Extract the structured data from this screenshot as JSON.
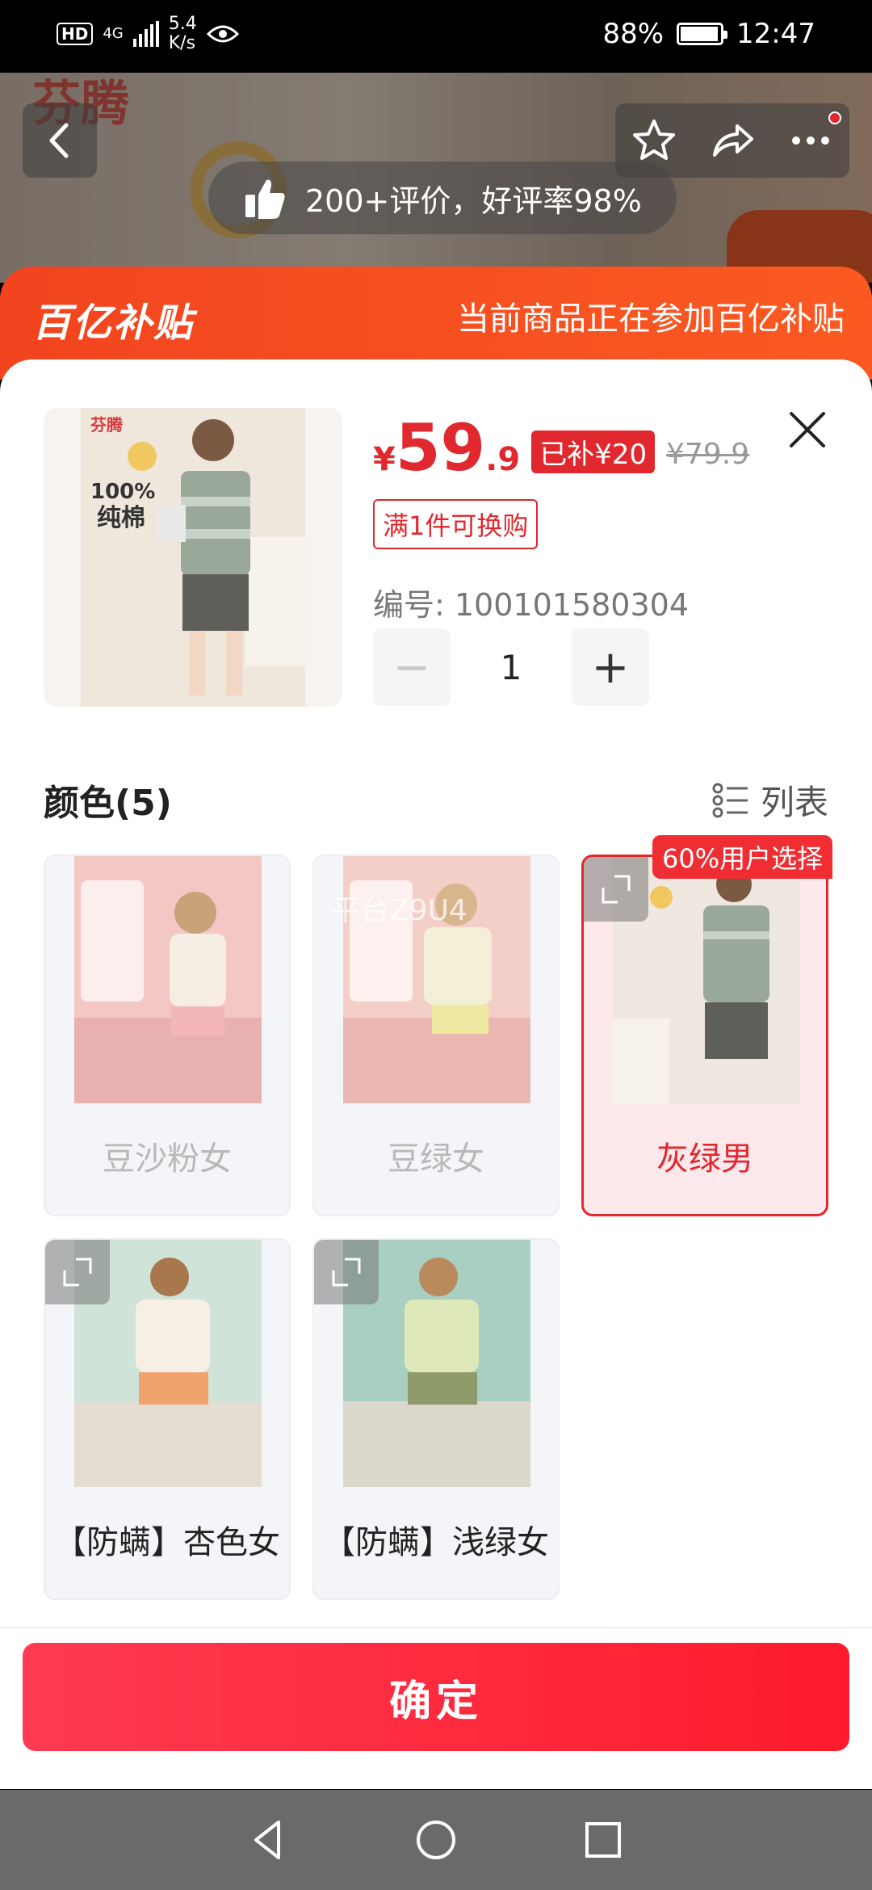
{
  "status_bar": {
    "hd": "HD",
    "network": "4G",
    "speed_value": "5.4",
    "speed_unit": "K/s",
    "battery": "88%",
    "time": "12:47"
  },
  "header": {
    "brand_logo": "芬腾",
    "rating_text": "200+评价，好评率98%",
    "icons": [
      "back-icon",
      "star-icon",
      "share-icon",
      "more-icon"
    ]
  },
  "subsidy": {
    "logo": "百亿补贴",
    "text": "当前商品正在参加百亿补贴"
  },
  "product": {
    "brand": "芬腾",
    "thumb_line1": "100%",
    "thumb_line2": "纯棉",
    "price_symbol": "¥",
    "price_int": "59",
    "price_dec": ".9",
    "subsidy_tag": "已补¥20",
    "original_price": "¥79.9",
    "swap_tag": "满1件可换购",
    "item_code": "编号: 100101580304",
    "quantity": "1",
    "minus": "−",
    "plus": "+"
  },
  "variants_section": {
    "title": "颜色(5)",
    "list_toggle": "列表",
    "hot_tag": "60%用户选择",
    "watermark": "平台Z9U4",
    "items": [
      {
        "label": "豆沙粉女",
        "state": "unavailable"
      },
      {
        "label": "豆绿女",
        "state": "unavailable"
      },
      {
        "label": "灰绿男",
        "state": "selected"
      },
      {
        "label": "【防螨】杏色女",
        "state": "available"
      },
      {
        "label": "【防螨】浅绿女",
        "state": "available"
      }
    ]
  },
  "confirm": {
    "label": "确定"
  },
  "colors": {
    "accent": "#e0282e",
    "subsidy_orange": "#f2441f",
    "button_red": "#ff1b2c"
  }
}
